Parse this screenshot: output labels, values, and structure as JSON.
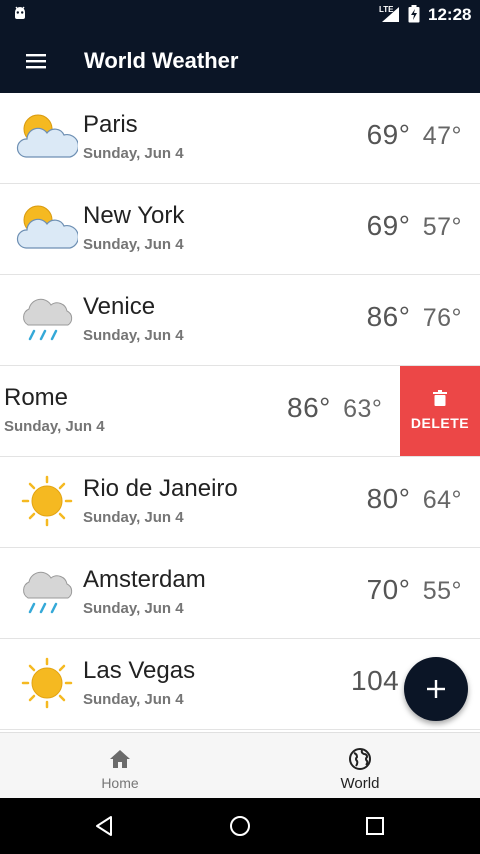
{
  "status_bar": {
    "network": "LTE",
    "time": "12:28"
  },
  "app_bar": {
    "title": "World Weather",
    "menu_icon": "hamburger-menu-icon"
  },
  "cities": [
    {
      "name": "Paris",
      "date": "Sunday, Jun 4",
      "high": "69°",
      "low": "47°",
      "icon": "partly-cloudy-icon"
    },
    {
      "name": "New York",
      "date": "Sunday, Jun 4",
      "high": "69°",
      "low": "57°",
      "icon": "partly-cloudy-icon"
    },
    {
      "name": "Venice",
      "date": "Sunday, Jun 4",
      "high": "86°",
      "low": "76°",
      "icon": "rain-cloud-icon"
    },
    {
      "name": "Rome",
      "date": "Sunday, Jun 4",
      "high": "86°",
      "low": "63°",
      "icon": "none",
      "swiped": true,
      "action_label": "DELETE"
    },
    {
      "name": "Rio de Janeiro",
      "date": "Sunday, Jun 4",
      "high": "80°",
      "low": "64°",
      "icon": "sun-icon"
    },
    {
      "name": "Amsterdam",
      "date": "Sunday, Jun 4",
      "high": "70°",
      "low": "55°",
      "icon": "rain-cloud-icon"
    },
    {
      "name": "Las Vegas",
      "date": "Sunday, Jun 4",
      "high": "104",
      "low": "",
      "icon": "sun-icon"
    }
  ],
  "fab": {
    "icon": "add-icon"
  },
  "bottom_nav": [
    {
      "label": "Home",
      "icon": "home-icon",
      "selected": false
    },
    {
      "label": "World",
      "icon": "globe-icon",
      "selected": true
    }
  ],
  "system_nav": [
    "back",
    "home",
    "recents"
  ],
  "colors": {
    "primary": "#0b1526",
    "delete": "#ec4747",
    "sun": "#f5b921",
    "rain": "#35a9d8"
  }
}
